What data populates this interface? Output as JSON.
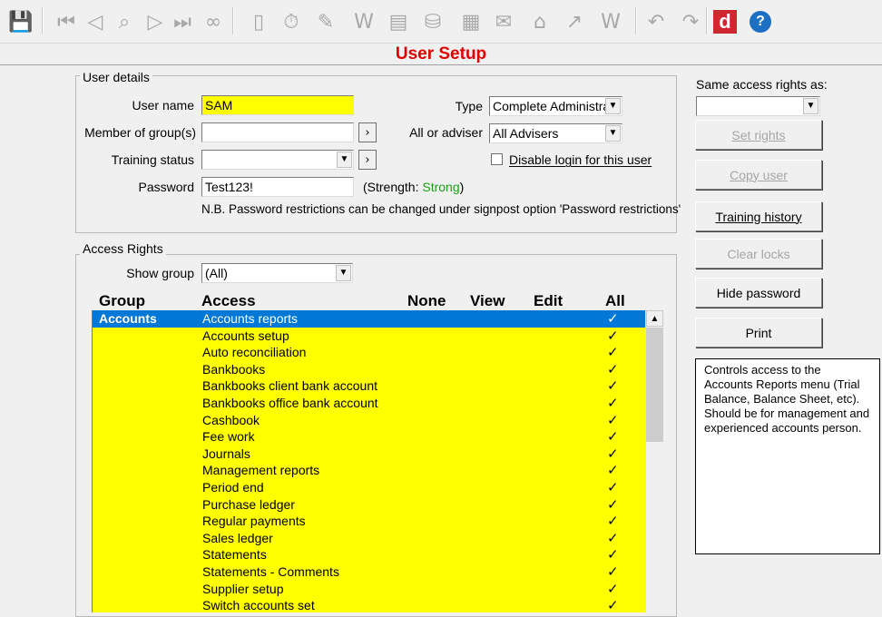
{
  "toolbar": {
    "icons": [
      {
        "name": "save-icon",
        "glyph": "💾"
      },
      {
        "name": "first-record-icon",
        "glyph": "⏮"
      },
      {
        "name": "previous-record-icon",
        "glyph": "◁"
      },
      {
        "name": "find-icon",
        "glyph": "⌕"
      },
      {
        "name": "next-record-icon",
        "glyph": "▷"
      },
      {
        "name": "last-record-icon",
        "glyph": "⏭"
      },
      {
        "name": "glasses-icon",
        "glyph": "∞"
      },
      {
        "name": "notepad-icon",
        "glyph": "▯"
      },
      {
        "name": "stopwatch-icon",
        "glyph": "⏱"
      },
      {
        "name": "diary-icon",
        "glyph": "✎"
      },
      {
        "name": "word-document-icon",
        "glyph": "W"
      },
      {
        "name": "calendar-icon",
        "glyph": "▤"
      },
      {
        "name": "database-icon",
        "glyph": "⛁"
      },
      {
        "name": "calculator-icon",
        "glyph": "▦"
      },
      {
        "name": "email-icon",
        "glyph": "✉"
      },
      {
        "name": "home-icon",
        "glyph": "⌂"
      },
      {
        "name": "trend-icon",
        "glyph": "↗"
      },
      {
        "name": "word-icon",
        "glyph": "W"
      },
      {
        "name": "undo-icon",
        "glyph": "↶"
      },
      {
        "name": "redo-icon",
        "glyph": "↷"
      },
      {
        "name": "d-logo-icon",
        "glyph": "d"
      },
      {
        "name": "help-icon",
        "glyph": "?"
      }
    ],
    "brand_color": "#d0262f",
    "help_color": "#1d6fc4"
  },
  "title": "User Setup",
  "user_details": {
    "group_label": "User details",
    "username_label": "User name",
    "username_value": "SAM",
    "member_label": "Member of group(s)",
    "member_value": "",
    "training_label": "Training status",
    "training_value": "",
    "password_label": "Password",
    "password_value": "Test123!",
    "strength_prefix": "(Strength: ",
    "strength_value": "Strong",
    "strength_suffix": ")",
    "strength_color": "#17a117",
    "type_label": "Type",
    "type_value": "Complete Administrat",
    "adviser_label": "All or adviser",
    "adviser_value": "All Advisers",
    "disable_login_label": "Disable login for this user",
    "note": "N.B. Password restrictions can be changed under signpost option 'Password restrictions'"
  },
  "access_rights": {
    "group_label": "Access Rights",
    "show_group_label": "Show group",
    "show_group_value": "(All)",
    "headers": {
      "group": "Group",
      "access": "Access",
      "none": "None",
      "view": "View",
      "edit": "Edit",
      "all": "All"
    },
    "rows": [
      {
        "group": "Accounts",
        "access": "Accounts reports",
        "tick": "✓"
      },
      {
        "group": "",
        "access": "Accounts setup",
        "tick": "✓"
      },
      {
        "group": "",
        "access": "Auto reconciliation",
        "tick": "✓"
      },
      {
        "group": "",
        "access": "Bankbooks",
        "tick": "✓"
      },
      {
        "group": "",
        "access": "Bankbooks client bank account",
        "tick": "✓"
      },
      {
        "group": "",
        "access": "Bankbooks office bank account",
        "tick": "✓"
      },
      {
        "group": "",
        "access": "Cashbook",
        "tick": "✓"
      },
      {
        "group": "",
        "access": "Fee work",
        "tick": "✓"
      },
      {
        "group": "",
        "access": "Journals",
        "tick": "✓"
      },
      {
        "group": "",
        "access": "Management reports",
        "tick": "✓"
      },
      {
        "group": "",
        "access": "Period end",
        "tick": "✓"
      },
      {
        "group": "",
        "access": "Purchase ledger",
        "tick": "✓"
      },
      {
        "group": "",
        "access": "Regular payments",
        "tick": "✓"
      },
      {
        "group": "",
        "access": "Sales ledger",
        "tick": "✓"
      },
      {
        "group": "",
        "access": "Statements",
        "tick": "✓"
      },
      {
        "group": "",
        "access": "Statements - Comments",
        "tick": "✓"
      },
      {
        "group": "",
        "access": "Supplier setup",
        "tick": "✓"
      },
      {
        "group": "",
        "access": "Switch accounts set",
        "tick": "✓"
      }
    ]
  },
  "side_panel": {
    "same_access_label": "Same access rights as:",
    "same_access_value": "",
    "set_rights": "Set rights",
    "copy_user": "Copy user",
    "training_history": "Training history",
    "clear_locks": "Clear locks",
    "hide_password": "Hide password",
    "print": "Print",
    "description": "Controls access to the Accounts Reports menu (Trial Balance, Balance Sheet, etc). Should be for management and experienced accounts person."
  }
}
